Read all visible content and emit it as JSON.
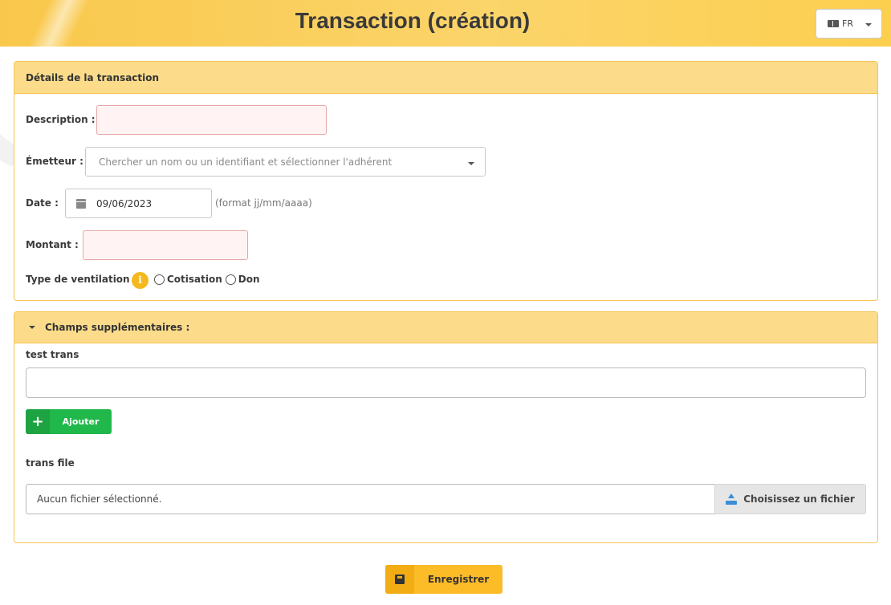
{
  "header": {
    "title": "Transaction (création)",
    "language": "FR"
  },
  "details": {
    "heading": "Détails de la transaction",
    "description_label": "Description :",
    "description_value": "",
    "emitter_label": "Émetteur :",
    "emitter_placeholder": "Chercher un nom ou un identifiant et sélectionner l'adhérent",
    "date_label": "Date :",
    "date_value": "09/06/2023",
    "date_hint": "(format jj/mm/aaaa)",
    "amount_label": "Montant :",
    "amount_value": "",
    "ventilation_label": "Type de ventilation :",
    "ventilation_options": [
      "Cotisation",
      "Don"
    ]
  },
  "extra": {
    "heading": "Champs supplémentaires :",
    "field1_label": "test trans",
    "field1_value": "",
    "add_label": "Ajouter",
    "field2_label": "trans file",
    "file_status": "Aucun fichier sélectionné.",
    "choose_file_label": "Choisissez un fichier"
  },
  "actions": {
    "save_label": "Enregistrer"
  },
  "colors": {
    "brand": "#fcbc28",
    "panel_header": "#fcdc8a",
    "add_button": "#20b84a",
    "required_field_bg": "#fff4f3"
  }
}
